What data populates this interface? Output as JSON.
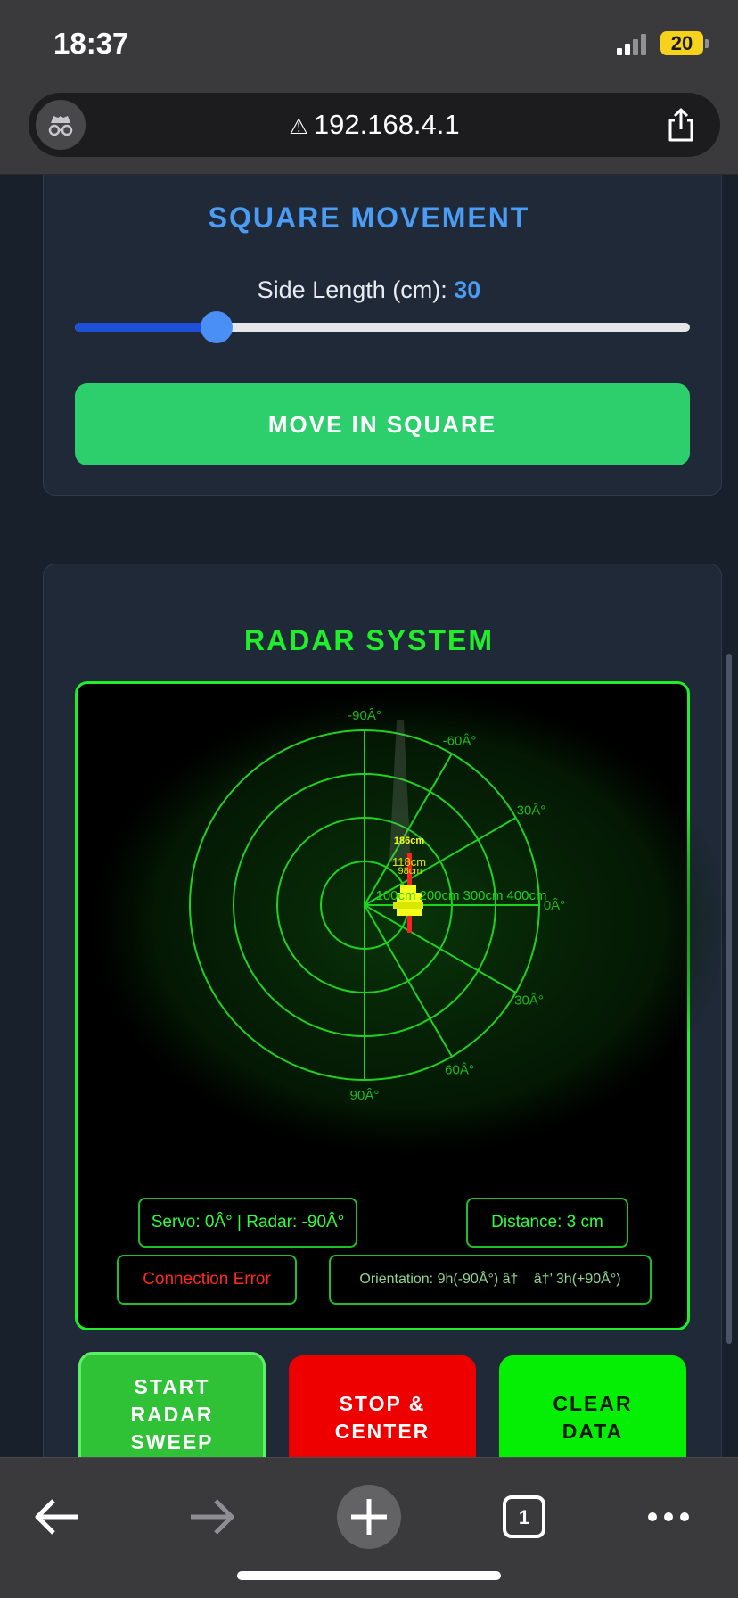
{
  "status_bar": {
    "time": "18:37",
    "battery": "20"
  },
  "browser": {
    "url": "192.168.4.1",
    "tab_count": "1"
  },
  "square": {
    "title": "SQUARE MOVEMENT",
    "side_label": "Side Length (cm):",
    "side_value": "30",
    "slider_fraction": 0.23,
    "button": "MOVE IN SQUARE"
  },
  "radar": {
    "title": "RADAR SYSTEM",
    "angle_labels": [
      "-90Â°",
      "-60Â°",
      "-30Â°",
      "0Â°",
      "30Â°",
      "60Â°",
      "90Â°"
    ],
    "range_labels": [
      "100cm",
      "200cm",
      "300cm",
      "400cm"
    ],
    "point_labels": [
      "186cm",
      "118cm",
      "98cm"
    ],
    "servo": "Servo: 0Â° | Radar: -90Â°",
    "distance": "Distance: 3 cm",
    "connection": "Connection Error",
    "orientation": "Orientation: 9h(-90Â°) â† â†’ 3h(+90Â°)"
  },
  "buttons": {
    "start": [
      "START",
      "RADAR",
      "SWEEP"
    ],
    "stop": [
      "STOP &",
      "CENTER"
    ],
    "clear": [
      "CLEAR",
      "DATA"
    ]
  },
  "colors": {
    "accent_blue": "#4a9cf5",
    "radar_green": "#1fef2a",
    "stop_red": "#ef0000",
    "go_green": "#2ccf6c"
  }
}
